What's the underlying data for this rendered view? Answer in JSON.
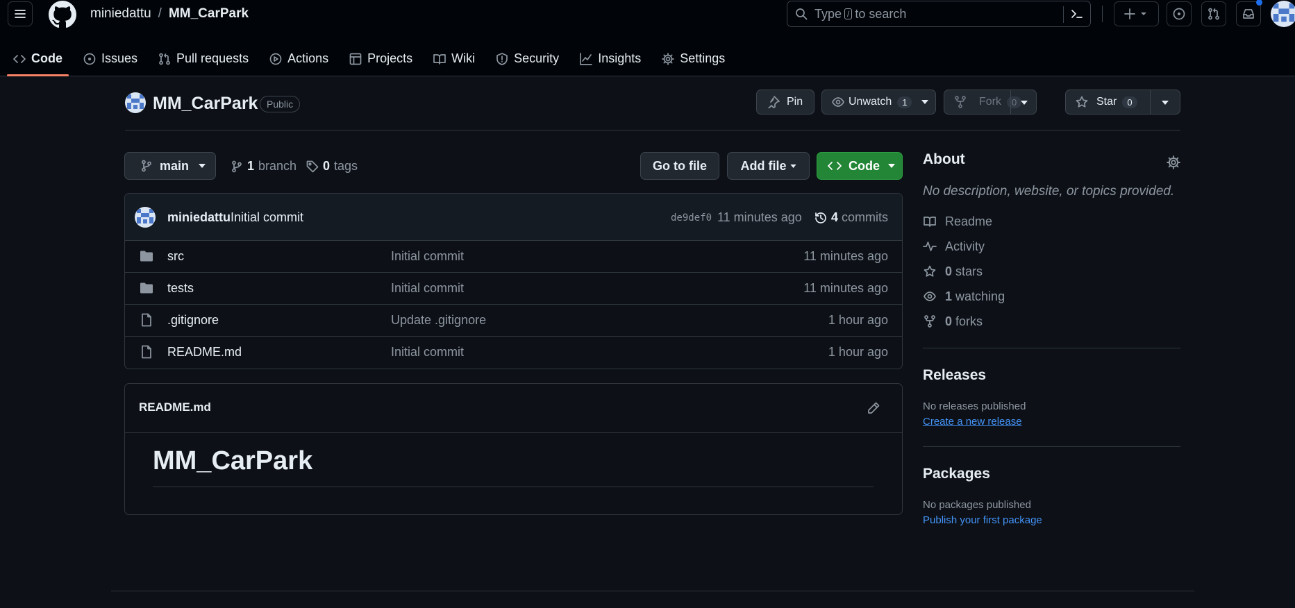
{
  "header": {
    "owner": "miniedattu",
    "separator": "/",
    "repo": "MM_CarPark",
    "search": {
      "before": "Type",
      "key": "/",
      "after": "to search"
    }
  },
  "tabs": [
    {
      "label": "Code",
      "icon": "code-icon"
    },
    {
      "label": "Issues",
      "icon": "issue-icon"
    },
    {
      "label": "Pull requests",
      "icon": "pull-request-icon"
    },
    {
      "label": "Actions",
      "icon": "play-icon"
    },
    {
      "label": "Projects",
      "icon": "table-icon"
    },
    {
      "label": "Wiki",
      "icon": "book-icon"
    },
    {
      "label": "Security",
      "icon": "shield-icon"
    },
    {
      "label": "Insights",
      "icon": "graph-icon"
    },
    {
      "label": "Settings",
      "icon": "gear-icon"
    }
  ],
  "repo": {
    "name": "MM_CarPark",
    "visibility": "Public",
    "pin_label": "Pin",
    "unwatch_label": "Unwatch",
    "watch_count": "1",
    "fork_label": "Fork",
    "fork_count": "0",
    "star_label": "Star",
    "star_count": "0"
  },
  "branch": {
    "current": "main",
    "branch_count": "1",
    "branch_word": "branch",
    "tag_count": "0",
    "tag_word": "tags"
  },
  "actions": {
    "go_to_file": "Go to file",
    "add_file": "Add file",
    "code": "Code"
  },
  "commit": {
    "author": "miniedattu",
    "message": "Initial commit",
    "hash": "de9def0",
    "time": "11 minutes ago",
    "count": "4",
    "count_word": "commits"
  },
  "files": [
    {
      "name": "src",
      "type": "folder",
      "message": "Initial commit",
      "time": "11 minutes ago"
    },
    {
      "name": "tests",
      "type": "folder",
      "message": "Initial commit",
      "time": "11 minutes ago"
    },
    {
      "name": ".gitignore",
      "type": "file",
      "message": "Update .gitignore",
      "time": "1 hour ago"
    },
    {
      "name": "README.md",
      "type": "file",
      "message": "Initial commit",
      "time": "1 hour ago"
    }
  ],
  "readme": {
    "filename": "README.md",
    "heading": "MM_CarPark"
  },
  "about": {
    "title": "About",
    "description": "No description, website, or topics provided.",
    "readme": "Readme",
    "activity": "Activity",
    "stars_count": "0",
    "stars_word": "stars",
    "watching_count": "1",
    "watching_word": "watching",
    "forks_count": "0",
    "forks_word": "forks"
  },
  "releases": {
    "title": "Releases",
    "none": "No releases published",
    "create": "Create a new release"
  },
  "packages": {
    "title": "Packages",
    "none": "No packages published",
    "publish": "Publish your first package"
  },
  "colors": {
    "bg": "#0d1117",
    "header": "#010409",
    "border": "#30363d",
    "accent_tab": "#f78166",
    "green": "#238636",
    "link": "#4493f8",
    "notif": "#1f6feb"
  }
}
